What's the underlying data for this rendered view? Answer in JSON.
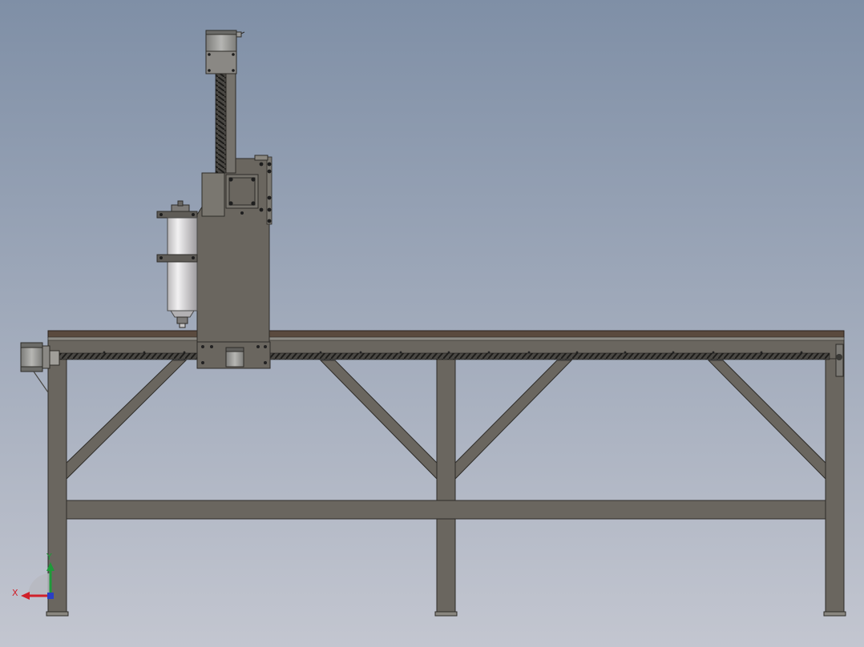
{
  "viewport": {
    "background_top": "#7f8fa6",
    "background_bottom": "#c3c6d0"
  },
  "model": {
    "frame_color": "#6a665f",
    "frame_edge": "#2e2c28",
    "table_top_color": "#5a4a3e",
    "spindle_color": "#d7d5d6",
    "motor_color": "#9a9a97",
    "ballscrew_color": "#3a3936"
  },
  "triad": {
    "x_label": "X",
    "y_label": "Y",
    "x_color": "#d0202a",
    "y_color": "#1f9a3a",
    "z_color": "#2a3fc4"
  }
}
